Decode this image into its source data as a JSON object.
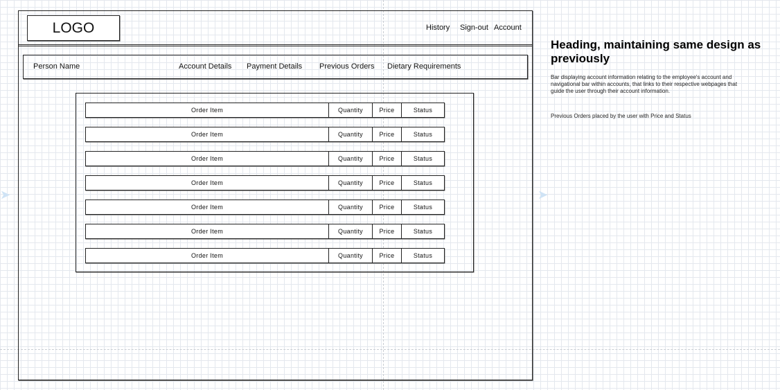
{
  "header": {
    "logo": "LOGO",
    "links": [
      "History",
      "Sign-out",
      "Account"
    ]
  },
  "account_bar": {
    "person_name": "Person Name",
    "items": [
      "Account Details",
      "Payment Details",
      "Previous Orders",
      "Dietary Requirements"
    ]
  },
  "orders": {
    "rows": [
      {
        "item": "Order Item",
        "quantity": "Quantity",
        "price": "Price",
        "status": "Status"
      },
      {
        "item": "Order Item",
        "quantity": "Quantity",
        "price": "Price",
        "status": "Status"
      },
      {
        "item": "Order Item",
        "quantity": "Quantity",
        "price": "Price",
        "status": "Status"
      },
      {
        "item": "Order Item",
        "quantity": "Quantity",
        "price": "Price",
        "status": "Status"
      },
      {
        "item": "Order Item",
        "quantity": "Quantity",
        "price": "Price",
        "status": "Status"
      },
      {
        "item": "Order Item",
        "quantity": "Quantity",
        "price": "Price",
        "status": "Status"
      },
      {
        "item": "Order Item",
        "quantity": "Quantity",
        "price": "Price",
        "status": "Status"
      }
    ]
  },
  "notes": {
    "heading": "Heading, maintaining same design as previously",
    "bar_description": "Bar displaying account information relating to the employee's account and navigational bar within accounts, that links to their respective webpages that guide the user through their account information.",
    "orders_description": "Previous Orders placed by the user with Price and Status"
  }
}
